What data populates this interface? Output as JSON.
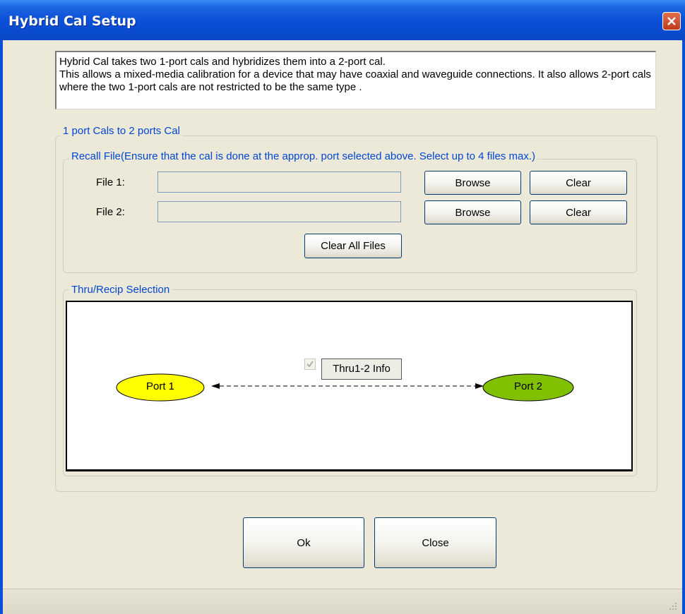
{
  "window": {
    "title": "Hybrid Cal Setup"
  },
  "info_text": "Hybrid Cal takes two 1-port cals and hybridizes them into a 2-port cal.\nThis allows a mixed-media calibration for a device that may have coaxial and waveguide connections.  It also allows 2-port cals where the two 1-port cals are not restricted to be the same type .",
  "cal_group": {
    "legend": "1 port Cals to 2 ports Cal",
    "recall": {
      "legend": "Recall File(Ensure that the cal is done at the approp. port selected above.  Select up to 4 files max.)",
      "files": [
        {
          "label": "File 1:",
          "value": "",
          "browse": "Browse",
          "clear": "Clear"
        },
        {
          "label": "File 2:",
          "value": "",
          "browse": "Browse",
          "clear": "Clear"
        }
      ],
      "clear_all": "Clear All Files"
    },
    "thru": {
      "legend": "Thru/Recip Selection",
      "port1": "Port 1",
      "port2": "Port 2",
      "port1_color": "#ffff00",
      "port2_color": "#80c000",
      "thru_checked": true,
      "thru_info": "Thru1-2 Info"
    }
  },
  "footer": {
    "ok": "Ok",
    "close": "Close"
  },
  "icons": {
    "close": "close-icon",
    "checkbox": "checkmark-icon",
    "resize": "resize-grip-icon"
  }
}
